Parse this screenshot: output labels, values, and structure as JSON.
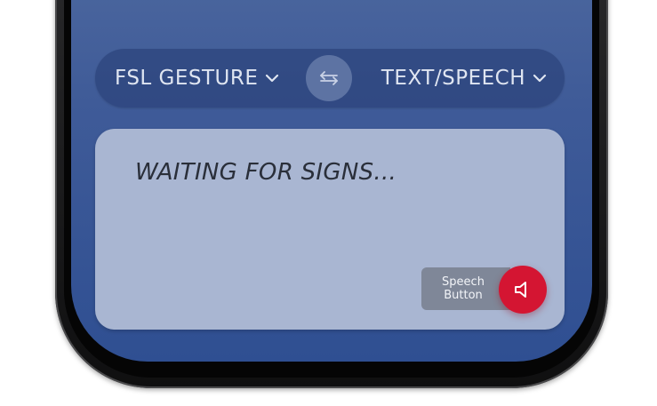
{
  "language_bar": {
    "source_language": "FSL GESTURE",
    "target_language": "TEXT/SPEECH",
    "swap_icon": "swap-arrows-icon",
    "dropdown_icon": "chevron-down-icon"
  },
  "output": {
    "status_text": "WAITING FOR SIGNS..."
  },
  "speech": {
    "label_line1": "Speech",
    "label_line2": "Button",
    "icon": "speaker-icon",
    "accent_color": "#d41532"
  },
  "colors": {
    "screen_top": "#4f6aa0",
    "screen_bottom": "#2f4f92",
    "card_background": "#a9b6d2"
  }
}
